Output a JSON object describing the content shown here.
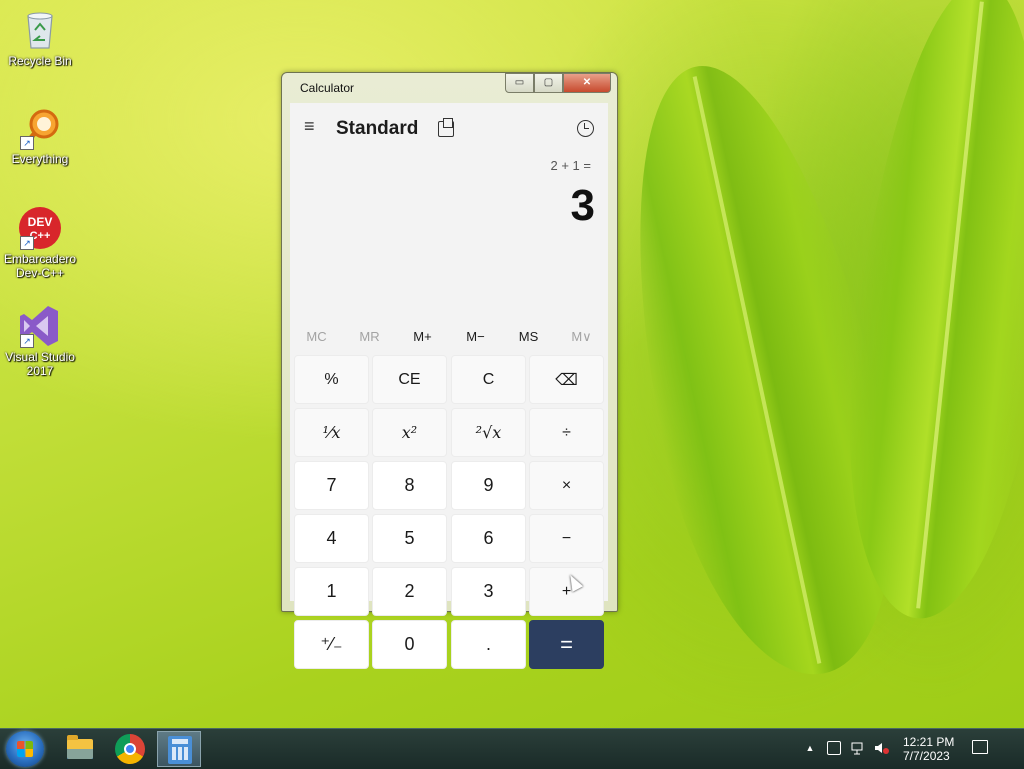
{
  "desktop": {
    "icons": [
      {
        "label": "Recycle Bin"
      },
      {
        "label": "Everything"
      },
      {
        "label": "Embarcadero Dev-C++",
        "logo_text": "DEV C++"
      },
      {
        "label": "Visual Studio 2017"
      }
    ]
  },
  "window": {
    "title": "Calculator",
    "min_glyph": "▭",
    "max_glyph": "▢",
    "close_glyph": "✕"
  },
  "calculator": {
    "mode": "Standard",
    "menu_glyph": "≡",
    "expression": "2 + 1 =",
    "result": "3",
    "memory": [
      "MC",
      "MR",
      "M+",
      "M−",
      "MS",
      "M∨"
    ],
    "memory_disabled": [
      true,
      true,
      false,
      false,
      false,
      true
    ],
    "keys": {
      "percent": "%",
      "ce": "CE",
      "c": "C",
      "backspace": "⌫",
      "reciprocal": "¹⁄x",
      "square": "x²",
      "sqrt": "²√x",
      "divide": "÷",
      "seven": "7",
      "eight": "8",
      "nine": "9",
      "multiply": "×",
      "four": "4",
      "five": "5",
      "six": "6",
      "minus": "−",
      "one": "1",
      "two": "2",
      "three": "3",
      "plus": "+",
      "negate": "⁺⁄₋",
      "zero": "0",
      "decimal": ".",
      "equals": "="
    },
    "equals_color": "#2c3e60"
  },
  "taskbar": {
    "time": "12:21 PM",
    "date": "7/7/2023",
    "tray_arrow": "▲"
  }
}
